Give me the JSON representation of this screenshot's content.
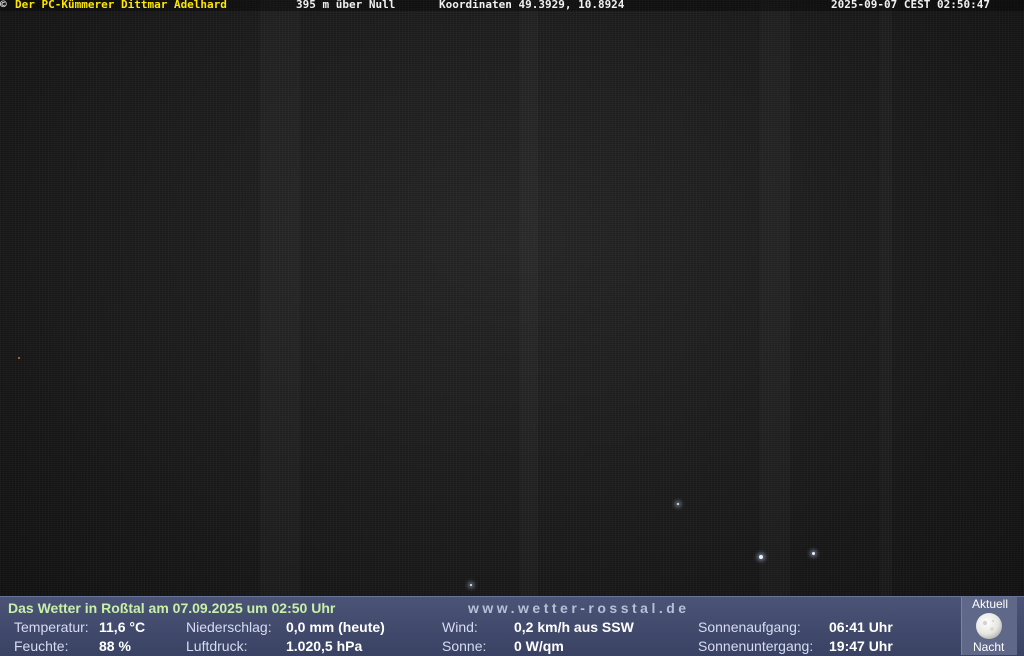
{
  "overlay": {
    "copyright_symbol": "©",
    "owner": "Der PC-Kümmerer Dittmar Adelhard",
    "altitude": "395 m über Null",
    "coordinates": "Koordinaten 49.3929, 10.8924",
    "timestamp": "2025-09-07 CEST 02:50:47",
    "owner_color": "#ffe600"
  },
  "weather": {
    "headline": "Das Wetter in Roßtal am 07.09.2025 um 02:50 Uhr",
    "website": "www.wetter-rosstal.de",
    "temperature_label": "Temperatur:",
    "temperature_value": "11,6 °C",
    "humidity_label": "Feuchte:",
    "humidity_value": "88 %",
    "precip_label": "Niederschlag:",
    "precip_value": "0,0 mm (heute)",
    "pressure_label": "Luftdruck:",
    "pressure_value": "1.020,5 hPa",
    "wind_label": "Wind:",
    "wind_value": "0,2 km/h aus SSW",
    "sun_label": "Sonne:",
    "sun_value": "0 W/qm",
    "sunrise_label": "Sonnenaufgang:",
    "sunrise_value": "06:41 Uhr",
    "sunset_label": "Sonnenuntergang:",
    "sunset_value": "19:47 Uhr",
    "moon_top": "Aktuell",
    "moon_bottom": "Nacht",
    "moon_icon": "moon-icon",
    "bar_color": "#434b6d"
  }
}
